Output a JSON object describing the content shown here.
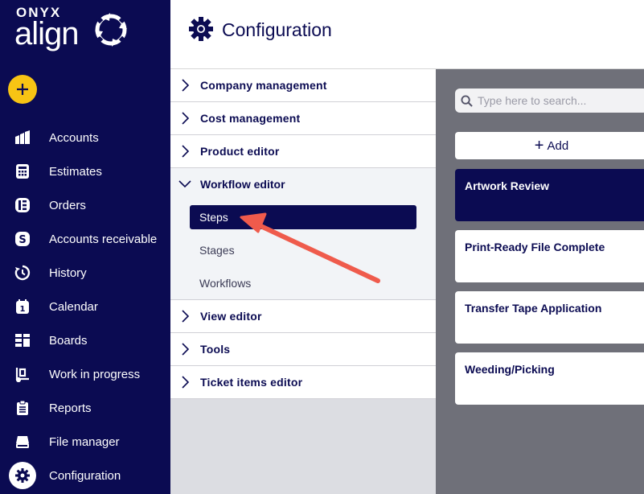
{
  "logo": {
    "brand_top": "ONYX",
    "brand_main": "align"
  },
  "sidebar": {
    "add_button_icon": "plus-icon",
    "items": [
      {
        "label": "Accounts",
        "icon": "accounts-icon"
      },
      {
        "label": "Estimates",
        "icon": "calculator-icon"
      },
      {
        "label": "Orders",
        "icon": "orders-icon"
      },
      {
        "label": "Accounts receivable",
        "icon": "dollar-icon"
      },
      {
        "label": "History",
        "icon": "history-icon"
      },
      {
        "label": "Calendar",
        "icon": "calendar-icon"
      },
      {
        "label": "Boards",
        "icon": "boards-icon"
      },
      {
        "label": "Work in progress",
        "icon": "work-in-progress-icon"
      },
      {
        "label": "Reports",
        "icon": "clipboard-icon"
      },
      {
        "label": "File manager",
        "icon": "drive-icon"
      },
      {
        "label": "Configuration",
        "icon": "gear-icon"
      }
    ]
  },
  "header": {
    "title": "Configuration",
    "icon": "gear-icon"
  },
  "menu": {
    "company_management": "Company management",
    "cost_management": "Cost management",
    "product_editor": "Product editor",
    "workflow_editor": "Workflow editor",
    "workflow_sub": [
      "Steps",
      "Stages",
      "Workflows"
    ],
    "view_editor": "View editor",
    "tools": "Tools",
    "ticket_items_editor": "Ticket items editor"
  },
  "list": {
    "search_placeholder": "Type here to search...",
    "add_label": "Add",
    "cards": [
      "Artwork Review",
      "Print-Ready File Complete",
      "Transfer Tape Application",
      "Weeding/Picking"
    ]
  },
  "colors": {
    "navy": "#0b0b52",
    "accent_yellow": "#f7c414",
    "annotation_arrow": "#ef5b4c"
  }
}
